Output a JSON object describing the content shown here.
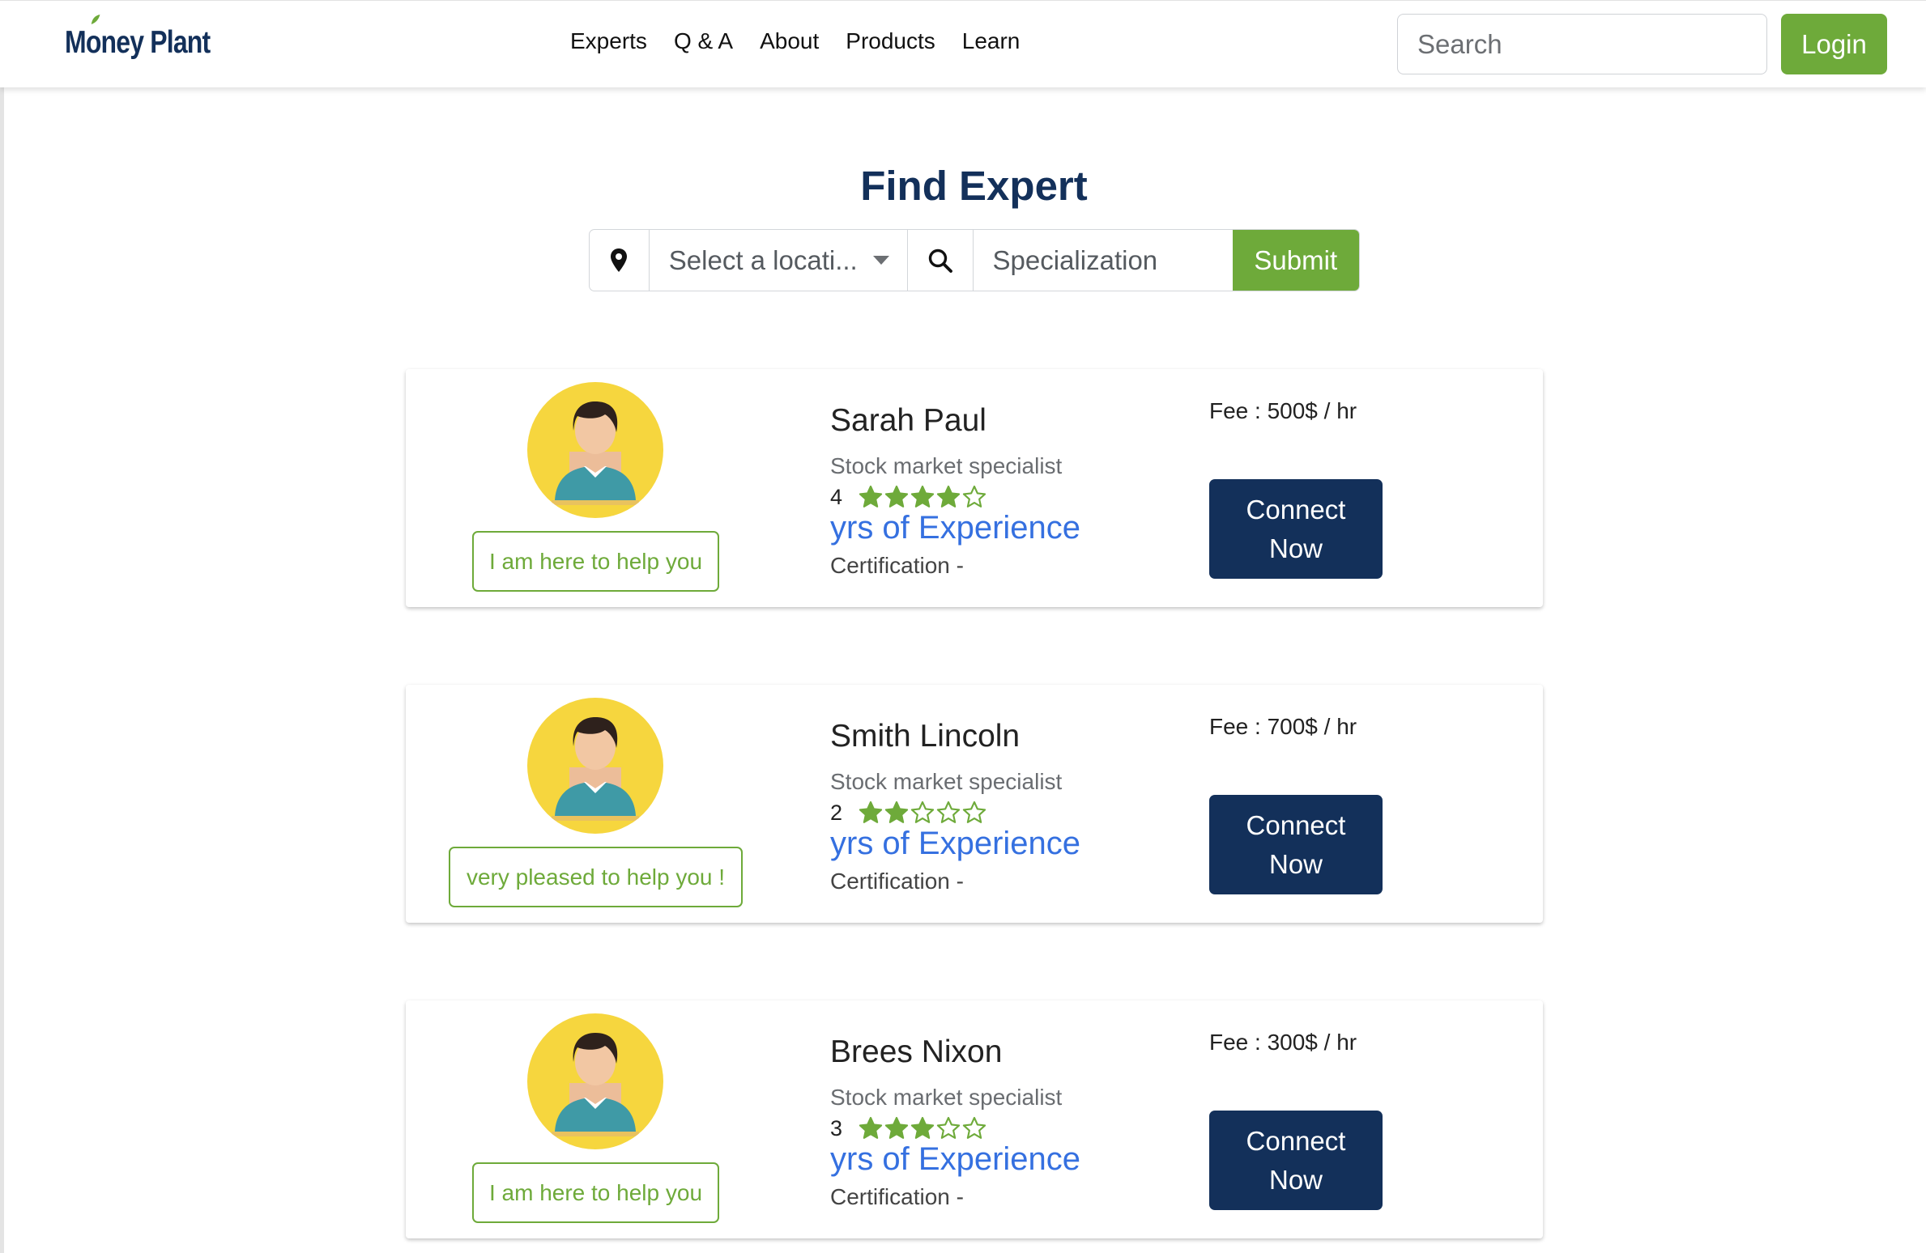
{
  "brand": {
    "logo_text": "Money Plant"
  },
  "nav": {
    "links": [
      {
        "label": "Experts"
      },
      {
        "label": "Q & A"
      },
      {
        "label": "About"
      },
      {
        "label": "Products"
      },
      {
        "label": "Learn"
      }
    ],
    "search_placeholder": "Search",
    "login_label": "Login"
  },
  "page": {
    "title": "Find Expert"
  },
  "filter": {
    "pin_icon": "map-pin-icon",
    "location_placeholder": "Select a location",
    "location_display": "Select a locati...",
    "search_icon": "search-icon",
    "specialization_placeholder": "Specialization",
    "submit_label": "Submit"
  },
  "colors": {
    "brand_green": "#6eaa3a",
    "navy": "#13305a",
    "link_blue": "#3570e0",
    "avatar_bg": "#f6d63e"
  },
  "experts": [
    {
      "name": "Sarah Paul",
      "tagline": "I am here to help you",
      "specialization": "Stock market specialist",
      "rating_text": "4",
      "rating": 4,
      "max_rating": 5,
      "experience": "yrs of Experience",
      "certification": "Certification -",
      "fee": "Fee : 500$ / hr",
      "connect_label": "Connect Now"
    },
    {
      "name": "Smith Lincoln",
      "tagline": "very pleased to help you !",
      "specialization": "Stock market specialist",
      "rating_text": "2",
      "rating": 2,
      "max_rating": 5,
      "experience": "yrs of Experience",
      "certification": "Certification -",
      "fee": "Fee : 700$ / hr",
      "connect_label": "Connect Now"
    },
    {
      "name": "Brees Nixon",
      "tagline": "I am here to help you",
      "specialization": "Stock market specialist",
      "rating_text": "3",
      "rating": 3,
      "max_rating": 5,
      "experience": "yrs of Experience",
      "certification": "Certification -",
      "fee": "Fee : 300$ / hr",
      "connect_label": "Connect Now"
    }
  ]
}
